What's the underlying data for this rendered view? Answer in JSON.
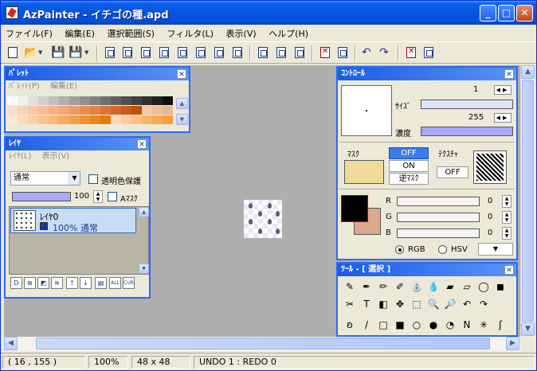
{
  "window": {
    "title": "AzPainter - イチゴの種.apd",
    "controls": [
      "_",
      "□",
      "✕"
    ]
  },
  "menubar": [
    "ファイル(F)",
    "編集(E)",
    "選択範囲(S)",
    "フィルタ(L)",
    "表示(V)",
    "ヘルプ(H)"
  ],
  "toolbar": {
    "icons": [
      "new-file-icon",
      "open-folder-icon",
      "dropdown-icon",
      "save-icon",
      "save-as-icon",
      "dropdown-icon",
      "layer-btn-1-icon",
      "layer-btn-2-icon",
      "layer-btn-3-icon",
      "layer-btn-4-icon",
      "layer-btn-5-icon",
      "layer-btn-6-icon",
      "layer-btn-7-icon",
      "layer-btn-8-icon",
      "grid-icon",
      "checker-icon",
      "move-icon",
      "clear-icon",
      "window-icon",
      "undo-icon",
      "redo-icon",
      "color-icon",
      "palette-icon"
    ]
  },
  "palette_panel": {
    "title": "ﾊﾟﾚｯﾄ",
    "menu": [
      "ﾊﾟﾚｯﾄ(P)",
      "編集(E)"
    ],
    "rows": [
      [
        "#ffffff",
        "#f0f0f0",
        "#e0e0e0",
        "#d0d0d0",
        "#c0c0c0",
        "#b0b0b0",
        "#a0a0a0",
        "#909090",
        "#808080",
        "#707070",
        "#606060",
        "#505050",
        "#404040",
        "#303030",
        "#202020",
        "#101010"
      ],
      [
        "#f8e0c8",
        "#f8d4b8",
        "#f8c8a8",
        "#f8bc98",
        "#f8b088",
        "#f8a478",
        "#f09868",
        "#e88c58",
        "#e08048",
        "#d87438",
        "#d06828",
        "#c85c18",
        "#c05008",
        "#f4c8a0",
        "#ecc098",
        "#e4b890"
      ],
      [
        "#f8e8d8",
        "#f8dcc0",
        "#f8d0a8",
        "#f8c490",
        "#f8b878",
        "#f4ac60",
        "#f0a048",
        "#ec9430",
        "#e88818",
        "#e47c00",
        "#f8d8b8",
        "#f8ccA0",
        "#f8c088",
        "#f8b470",
        "#f8a858",
        "#f89c40"
      ]
    ]
  },
  "layer_panel": {
    "title": "ﾚｲﾔ",
    "menu": [
      "ﾚｲﾔ(L)",
      "表示(V)"
    ],
    "blend_mode": "通常",
    "transparency_lock_label": "透明色保護",
    "opacity_value": "100",
    "amask_label": "Aﾏｽｸ",
    "layer": {
      "name": "ﾚｲﾔ0",
      "info": "100% 通常"
    },
    "buttons": [
      "D",
      "⧉",
      "◩",
      "≋",
      "↑",
      "↓",
      "▤",
      "ALL",
      "CUR"
    ]
  },
  "control_panel": {
    "title": "ｺﾝﾄﾛｰﾙ",
    "size_label": "ｻｲｽﾞ",
    "size_value": "1",
    "density_label": "濃度",
    "density_value": "255",
    "mask_label": "ﾏｽｸ",
    "mask_options": [
      "OFF",
      "ON",
      "逆ﾏｽｸ"
    ],
    "texture_label": "ﾃｸｽﾁｬ",
    "texture_value": "OFF",
    "channels": [
      {
        "label": "R",
        "value": "0"
      },
      {
        "label": "G",
        "value": "0"
      },
      {
        "label": "B",
        "value": "0"
      }
    ],
    "mode_rgb": "RGB",
    "mode_hsv": "HSV",
    "fg_color": "#000000",
    "bg_color": "#d9a98e",
    "mask_color": "#f0dc98"
  },
  "tool_panel": {
    "title": "ﾂｰﾙ - [ 選択 ]",
    "row1": [
      "✎",
      "✒",
      "✏",
      "✐",
      "⛲",
      "💧",
      "▰",
      "▱",
      "◯",
      "◼"
    ],
    "row2": [
      "✂",
      "T",
      "◧",
      "✥",
      "⬚",
      "🔍",
      "🔎",
      "↶",
      "↷"
    ],
    "row3": [
      "ʚ",
      "/",
      "□",
      "■",
      "○",
      "●",
      "◔",
      "N",
      "✳",
      "ʃ"
    ]
  },
  "statusbar": {
    "coords": "( 16 , 155 )",
    "zoom": "100%",
    "size": "48 x  48",
    "undo": "UNDO   1 : REDO   0"
  }
}
